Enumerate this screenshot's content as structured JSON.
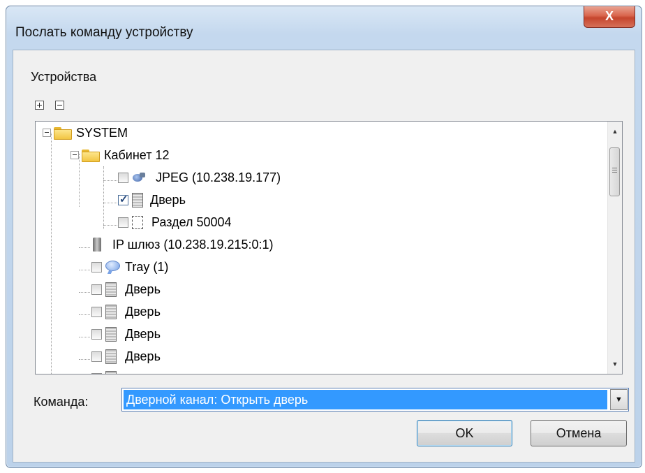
{
  "window": {
    "title": "Послать команду устройству",
    "close_glyph": "X"
  },
  "devices": {
    "label": "Устройства",
    "expand_all_icon": "plus-box-icon",
    "collapse_all_icon": "minus-box-icon",
    "tree": [
      {
        "label": "SYSTEM",
        "icon": "folder-icon"
      },
      {
        "label": "Кабинет 12",
        "icon": "folder-icon"
      },
      {
        "label": "JPEG (10.238.19.177)",
        "icon": "camera-icon",
        "checked": false
      },
      {
        "label": "Дверь",
        "icon": "door-icon",
        "checked": true
      },
      {
        "label": "Раздел 50004",
        "icon": "partition-icon",
        "checked": false
      },
      {
        "label": "IP шлюз (10.238.19.215:0:1)",
        "icon": "gateway-icon"
      },
      {
        "label": "Tray (1)",
        "icon": "tray-icon",
        "checked": false
      },
      {
        "label": "Дверь",
        "icon": "door-icon",
        "checked": false
      },
      {
        "label": "Дверь",
        "icon": "door-icon",
        "checked": false
      },
      {
        "label": "Дверь",
        "icon": "door-icon",
        "checked": false
      },
      {
        "label": "Дверь",
        "icon": "door-icon",
        "checked": false
      }
    ]
  },
  "command": {
    "label": "Команда:",
    "value": "Дверной канал: Открыть дверь"
  },
  "buttons": {
    "ok": "OK",
    "cancel": "Отмена"
  }
}
